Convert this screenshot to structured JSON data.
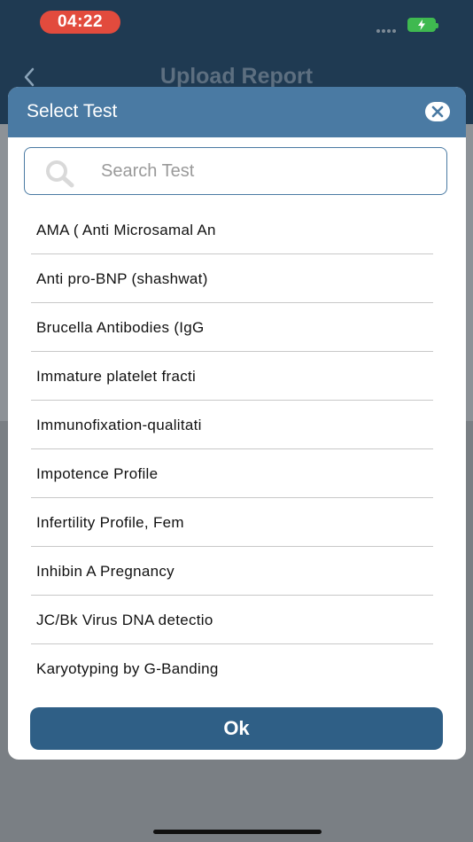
{
  "status_bar": {
    "time": "04:22"
  },
  "app": {
    "title": "Upload Report",
    "back_icon": "chevron-left-icon"
  },
  "modal": {
    "title": "Select Test",
    "close_icon": "close-icon",
    "search": {
      "placeholder": "Search Test",
      "value": ""
    },
    "items": [
      {
        "label": "AMA ( Anti Microsamal An"
      },
      {
        "label": "Anti pro-BNP (shashwat)"
      },
      {
        "label": "Brucella Antibodies (IgG"
      },
      {
        "label": "Immature platelet fracti"
      },
      {
        "label": "Immunofixation-qualitati"
      },
      {
        "label": "Impotence Profile"
      },
      {
        "label": "Infertility Profile, Fem"
      },
      {
        "label": "Inhibin A Pregnancy"
      },
      {
        "label": "JC/Bk Virus DNA detectio"
      },
      {
        "label": "Karyotyping by G-Banding"
      }
    ],
    "ok_label": "Ok"
  },
  "colors": {
    "header": "#1f3a52",
    "modal_header": "#4a7aa3",
    "ok_button": "#2f5f86",
    "status_time_bg": "#e24b3d",
    "battery": "#3fb950"
  }
}
